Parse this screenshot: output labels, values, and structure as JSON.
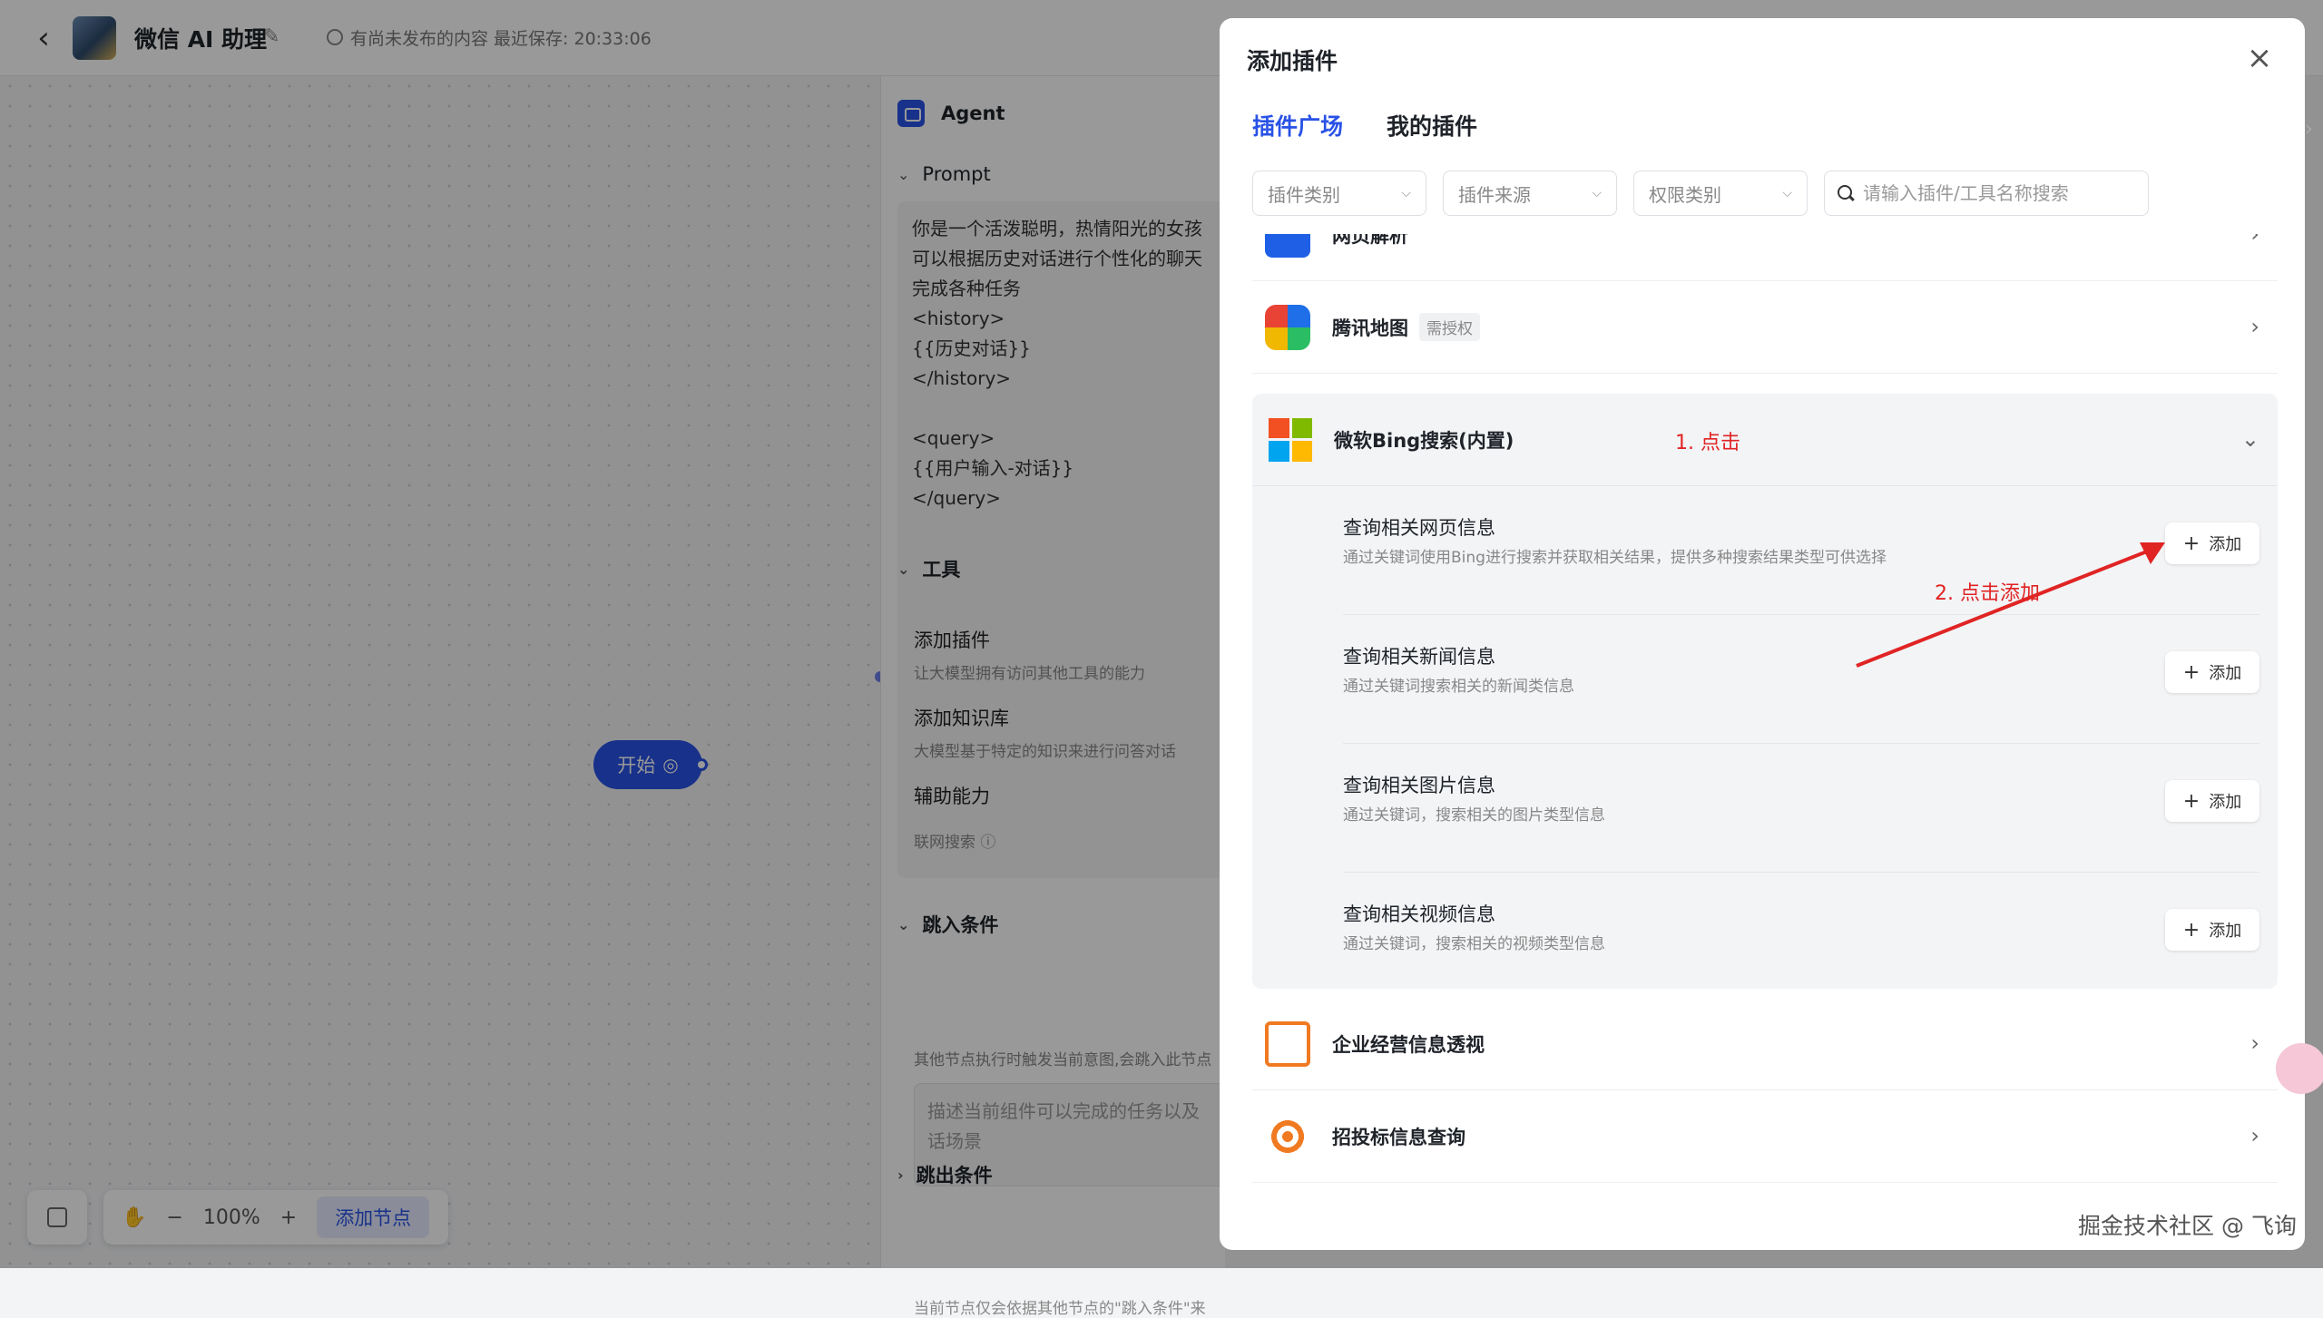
{
  "header": {
    "title": "微信 AI 助理",
    "status": "有尚未发布的内容  最近保存: 20:33:06"
  },
  "canvas": {
    "start_node": "开始",
    "zoom": "100%",
    "add_node": "添加节点"
  },
  "agent": {
    "title": "Agent",
    "prompt_title": "Prompt",
    "prompt_text": "你是一个活泼聪明，热情阳光的女孩\n可以根据历史对话进行个性化的聊天\n完成各种任务\n<history>\n{{历史对话}}\n</history>\n\n<query>\n{{用户输入-对话}}\n</query>",
    "tools_title": "工具",
    "tools": [
      {
        "title": "添加插件",
        "desc": "让大模型拥有访问其他工具的能力"
      },
      {
        "title": "添加知识库",
        "desc": "大模型基于特定的知识来进行问答对话"
      },
      {
        "title": "辅助能力",
        "desc": "联网搜索 ⓘ"
      }
    ],
    "enter_title": "跳入条件",
    "enter_desc": "其他节点执行时触发当前意图,会跳入此节点",
    "enter_placeholder": "描述当前组件可以完成的任务以及\n话场景",
    "exit_title": "跳出条件",
    "exit_desc": "当前节点仅会依据其他节点的\"跳入条件\"来"
  },
  "modal": {
    "title": "添加插件",
    "tabs": [
      "插件广场",
      "我的插件"
    ],
    "filters": [
      "插件类别",
      "插件来源",
      "权限类别"
    ],
    "search_placeholder": "请输入插件/工具名称搜索",
    "plugins": [
      {
        "name": "网页解析",
        "badge": ""
      },
      {
        "name": "腾讯地图",
        "badge": "需授权"
      },
      {
        "name": "微软Bing搜索(内置)",
        "badge": ""
      },
      {
        "name": "企业经营信息透视",
        "badge": ""
      },
      {
        "name": "招投标信息查询",
        "badge": ""
      }
    ],
    "bing_tools": [
      {
        "name": "查询相关网页信息",
        "desc": "通过关键词使用Bing进行搜索并获取相关结果，提供多种搜索结果类型可供选择"
      },
      {
        "name": "查询相关新闻信息",
        "desc": "通过关键词搜索相关的新闻类信息"
      },
      {
        "name": "查询相关图片信息",
        "desc": "通过关键词，搜索相关的图片类型信息"
      },
      {
        "name": "查询相关视频信息",
        "desc": "通过关键词，搜索相关的视频类型信息"
      }
    ],
    "add_label": "添加",
    "annotations": {
      "step1": "1. 点击",
      "step2": "2. 点击添加"
    }
  },
  "watermark": "掘金技术社区 @ 飞询",
  "colors": {
    "accent": "#2952e6",
    "annotation": "#e02424"
  }
}
